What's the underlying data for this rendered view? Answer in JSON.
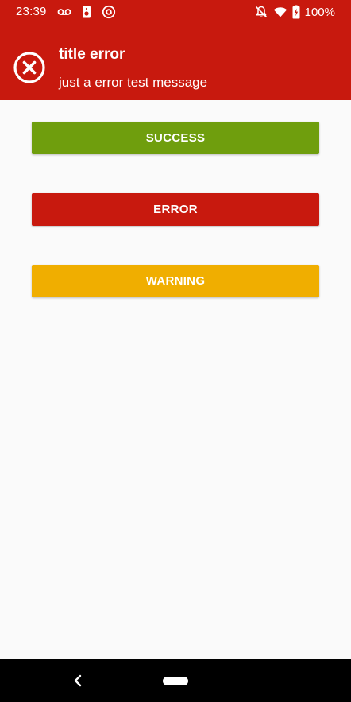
{
  "status_bar": {
    "time": "23:39",
    "battery_percent": "100%",
    "left_icons": [
      "voicemail-icon",
      "speaker-icon",
      "at-sign-icon"
    ],
    "right_icons": [
      "bell-off-icon",
      "wifi-icon",
      "battery-charging-icon"
    ]
  },
  "alert": {
    "icon": "error-circle-x-icon",
    "title": "title error",
    "message": "just a error test message",
    "color": "#c8190e"
  },
  "buttons": {
    "success_label": "SUCCESS",
    "error_label": "ERROR",
    "warning_label": "WARNING",
    "success_color": "#6f9e0d",
    "error_color": "#c8190e",
    "warning_color": "#f0ae00"
  },
  "nav_bar": {
    "icons": [
      "back-icon",
      "home-pill-icon"
    ]
  }
}
